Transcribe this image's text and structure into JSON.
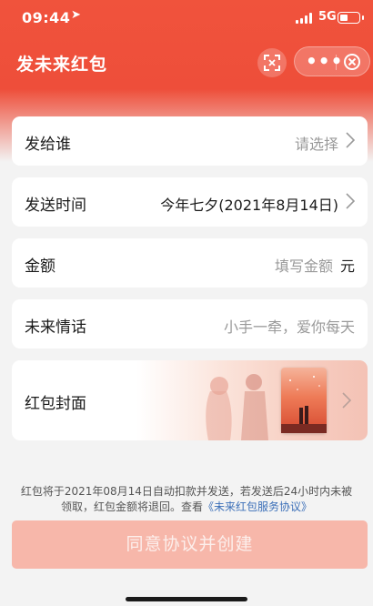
{
  "status_bar": {
    "time": "09:44",
    "network": "5G",
    "location_icon": "location-arrow-icon",
    "battery_icon": "battery-icon"
  },
  "nav": {
    "title": "发未来红包",
    "scan_icon": "scan-icon",
    "more_icon": "more-icon",
    "close_icon": "close-icon"
  },
  "form": {
    "recipient": {
      "label": "发给谁",
      "placeholder": "请选择"
    },
    "send_time": {
      "label": "发送时间",
      "value": "今年七夕(2021年8月14日)"
    },
    "amount": {
      "label": "金额",
      "placeholder": "填写金额",
      "unit": "元"
    },
    "message": {
      "label": "未来情话",
      "placeholder": "小手一牵，爱你每天"
    },
    "cover": {
      "label": "红包封面"
    }
  },
  "notice": {
    "text": "红包将于2021年08月14日自动扣款并发送，若发送后24小时内未被领取，红包金额将退回。查看",
    "link": "《未来红包服务协议》"
  },
  "create_button": {
    "label": "同意协议并创建"
  },
  "colors": {
    "header": "#f0533c",
    "button_disabled": "#f7b7aa",
    "link": "#3b6fb8"
  }
}
